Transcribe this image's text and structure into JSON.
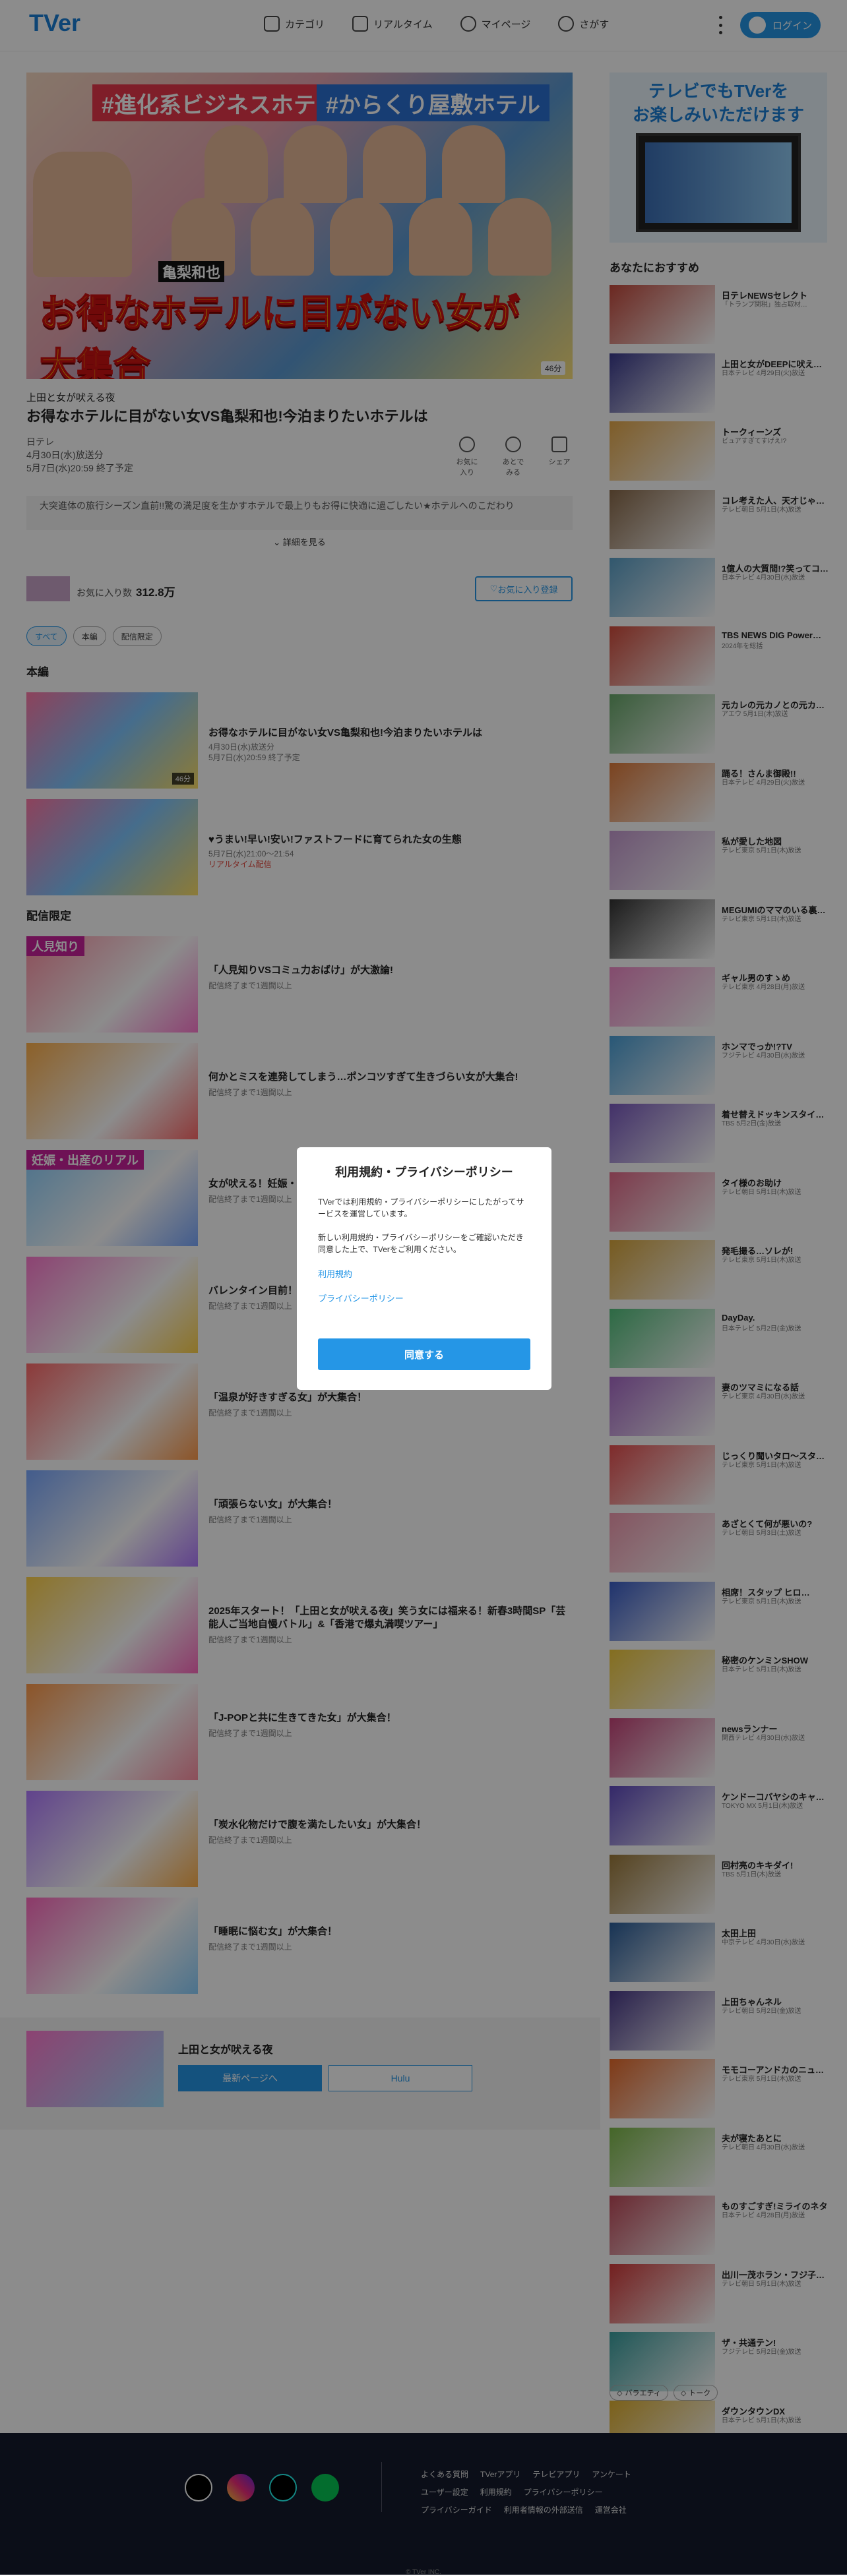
{
  "header": {
    "logo": "TVer",
    "nav": [
      "カテゴリ",
      "リアルタイム",
      "マイページ",
      "さがす"
    ],
    "login": "ログイン"
  },
  "hero": {
    "tags": [
      "#進化系ビジネスホテル",
      "#からくり屋敷ホテル"
    ],
    "guest": "亀梨和也",
    "title": "お得なホテルに目がない女が大集合",
    "badge": "46分"
  },
  "program": {
    "name": "上田と女が吠える夜",
    "episode_title": "お得なホテルに目がない女VS亀梨和也!今泊まりたいホテルは",
    "channel": "日テレ",
    "aired": "4月30日(水)放送分",
    "expires": "5月7日(水)20:59 終了予定",
    "actions": [
      "お気に入り",
      "あとでみる",
      "シェア"
    ],
    "description": "大突進体の旅行シーズン直前!!驚の満足度を生かすホテルで最上りもお得に快適に過ごしたい★ホテルへのこだわり",
    "more": "詳細を見る"
  },
  "favorites": {
    "label": "お気に入り数",
    "count": "312.8万",
    "button": "お気に入り登録"
  },
  "chips": [
    "すべて",
    "本編",
    "配信限定"
  ],
  "sections": {
    "main": "本編",
    "limited": "配信限定"
  },
  "episodes": [
    {
      "tag": "",
      "title": "お得なホテルに目がない女VS亀梨和也!今泊まりたいホテルは",
      "sub": "4月30日(水)放送分",
      "sub2": "5月7日(水)20:59 終了予定",
      "dur": "46分"
    },
    {
      "tag": "",
      "title": "♥うまい!早い!安い!ファストフードに育てられた女の生態",
      "sub": "5月7日(水)21:00～21:54",
      "sub2": "リアルタイム配信",
      "dur": ""
    }
  ],
  "limited_episodes": [
    {
      "tag": "人見知り",
      "title": "「人見知りVSコミュ力おばけ」が大激論!",
      "sub": "配信終了まで1週間以上"
    },
    {
      "tag": "",
      "title": "何かとミスを連発してしまう…ポンコツすぎて生きづらい女が大集合!",
      "sub": "配信終了まで1週間以上"
    },
    {
      "tag": "妊娠・出産のリアル",
      "title": "女が吠える！妊娠・出産のリアル",
      "sub": "配信終了まで1週間以上"
    },
    {
      "tag": "",
      "title": "バレンタイン目前！恋愛に悩む女が大集合",
      "sub": "配信終了まで1週間以上"
    },
    {
      "tag": "",
      "title": "「温泉が好きすぎる女」が大集合！",
      "sub": "配信終了まで1週間以上"
    },
    {
      "tag": "",
      "title": "「頑張らない女」が大集合！",
      "sub": "配信終了まで1週間以上"
    },
    {
      "tag": "",
      "title": "2025年スタート！「上田と女が吠える夜」笑う女には福来る！新春3時間SP「芸能人ご当地自慢バトル」&「香港で爆丸満喫ツアー」",
      "sub": "配信終了まで1週間以上"
    },
    {
      "tag": "",
      "title": "「J-POPと共に生きてきた女」が大集合！",
      "sub": "配信終了まで1週間以上"
    },
    {
      "tag": "",
      "title": "「炭水化物だけで腹を満たしたい女」が大集合！",
      "sub": "配信終了まで1週間以上"
    },
    {
      "tag": "",
      "title": "「睡眠に悩む女」が大集合！",
      "sub": "配信終了まで1週間以上"
    }
  ],
  "footer_banner": {
    "title": "上田と女が吠える夜",
    "btn1": "最新ページへ",
    "btn2": "Hulu"
  },
  "sidebar": {
    "ad": "テレビでもTVerを\nお楽しみいただけます",
    "heading": "あなたにおすすめ",
    "items": [
      {
        "title": "日テレNEWSセレクト",
        "sub": "「トランプ関税」独占取材…",
        "c": "#c4493c"
      },
      {
        "title": "上田と女がDEEPに吠える夜",
        "sub": "日本テレビ 4月29日(火)放送",
        "c": "#3b3b8f"
      },
      {
        "title": "トークィーンズ",
        "sub": "ビュアすぎてすげえ!?",
        "c": "#e6a94a"
      },
      {
        "title": "コレ考えた人、天才じゃね…",
        "sub": "テレビ朝日 5月1日(木)放送",
        "c": "#8a6a4a"
      },
      {
        "title": "1億人の大質問!?笑ってコ…",
        "sub": "日本テレビ 4月30日(水)放送",
        "c": "#5aa0c8"
      },
      {
        "title": "TBS NEWS DIG Power…",
        "sub": "2024年を総括",
        "c": "#d24b3b"
      },
      {
        "title": "元カレの元カノとの元カノ…",
        "sub": "アエウ 5月1日(木)放送",
        "c": "#68a86a"
      },
      {
        "title": "踊る！さんま御殿!!",
        "sub": "日本テレビ 4月29日(火)放送",
        "c": "#e07b3a"
      },
      {
        "title": "私が愛した地図",
        "sub": "テレビ東京 5月1日(木)放送",
        "c": "#c59ad0"
      },
      {
        "title": "MEGUMIのママのいる裏Bar",
        "sub": "テレビ東京 5月1日(木)放送",
        "c": "#333"
      },
      {
        "title": "ギャル男のすゝめ",
        "sub": "テレビ東京 4月28日(月)放送",
        "c": "#f08ac8"
      },
      {
        "title": "ホンマでっか!?TV",
        "sub": "フジテレビ 4月30日(水)放送",
        "c": "#4aa0d8"
      },
      {
        "title": "着せ替えドッキンスタイル…",
        "sub": "TBS 5月2日(金)放送",
        "c": "#7a5ac0"
      },
      {
        "title": "タイ様のお助け",
        "sub": "テレビ朝日 5月1日(木)放送",
        "c": "#e46a8a"
      },
      {
        "title": "発毛撮る…ソレが!",
        "sub": "テレビ東京 5月1日(木)放送",
        "c": "#d9a63b"
      },
      {
        "title": "DayDay.",
        "sub": "日本テレビ 5月2日(金)放送",
        "c": "#53c17d"
      },
      {
        "title": "妻のツマミになる話",
        "sub": "テレビ東京 4月30日(水)放送",
        "c": "#a86ac8"
      },
      {
        "title": "じっくり聞いタロ～スター…",
        "sub": "テレビ東京 5月1日(木)放送",
        "c": "#e84f4f"
      },
      {
        "title": "あざとくて何が悪いの?",
        "sub": "テレビ朝日 5月3日(土)放送",
        "c": "#f29ab0"
      },
      {
        "title": "相席！スタップ ヒロ…",
        "sub": "テレビ東京 5月1日(木)放送",
        "c": "#3a5ec8"
      },
      {
        "title": "秘密のケンミンSHOW",
        "sub": "日本テレビ 5月1日(木)放送",
        "c": "#f1c93a"
      },
      {
        "title": "newsランナー",
        "sub": "関西テレビ 4月30日(水)放送",
        "c": "#c7447a"
      },
      {
        "title": "ケンドーコバヤシのキャ…",
        "sub": "TOKYO MX 5月1日(木)放送",
        "c": "#5f4ac0"
      },
      {
        "title": "回村亮のキキダイ!",
        "sub": "TBS 5月1日(木)放送",
        "c": "#9c7a3a"
      },
      {
        "title": "太田上田",
        "sub": "中京テレビ 4月30日(水)放送",
        "c": "#2b5e9a"
      },
      {
        "title": "上田ちゃんネル",
        "sub": "テレビ朝日 5月2日(金)放送",
        "c": "#4a3a8a"
      },
      {
        "title": "モモコーアンドカのニュー…",
        "sub": "テレビ東京 5月1日(木)放送",
        "c": "#e86a2a"
      },
      {
        "title": "夫が寝たあとに",
        "sub": "テレビ朝日 4月30日(水)放送",
        "c": "#7dba4a"
      },
      {
        "title": "ものすごすぎ!ミライのネタ",
        "sub": "日本テレビ 4月28日(月)放送",
        "c": "#c04a5a"
      },
      {
        "title": "出川一茂ホラン・フジ子の会",
        "sub": "テレビ朝日 5月1日(木)放送",
        "c": "#d33a3a"
      },
      {
        "title": "ザ・共通テン!",
        "sub": "フジテレビ 5月2日(金)放送",
        "c": "#3aa0a0"
      },
      {
        "title": "ダウンタウンDX",
        "sub": "日本テレビ 5月1日(木)放送",
        "c": "#e0b030"
      }
    ],
    "tags": [
      "バラエティ",
      "トーク"
    ]
  },
  "footer": {
    "links": [
      "よくある質問",
      "TVerアプリ",
      "テレビアプリ",
      "アンケート",
      "ユーザー設定",
      "利用規約",
      "プライバシーポリシー",
      "プライバシーガイド",
      "利用者情報の外部送信",
      "運営会社"
    ],
    "copyright": "© TVer INC."
  },
  "modal": {
    "title": "利用規約・プライバシーポリシー",
    "p1": "TVerでは利用規約・プライバシーポリシーにしたがってサービスを運営しています。",
    "p2": "新しい利用規約・プライバシーポリシーをご確認いただき同意した上で、TVerをご利用ください。",
    "link1": "利用規約",
    "link2": "プライバシーポリシー",
    "ok": "同意する"
  },
  "colors": {
    "accent": "#2596e6",
    "realtime": "#e0453b"
  }
}
